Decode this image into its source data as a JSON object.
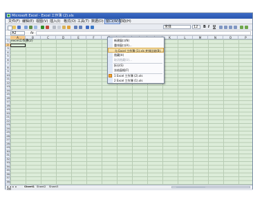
{
  "window": {
    "title": "Microsoft Excel - Excel 工作薄 (2).xls"
  },
  "menubar": {
    "items": [
      {
        "label": "文件(F)"
      },
      {
        "label": "编辑(E)"
      },
      {
        "label": "视图(V)"
      },
      {
        "label": "插入(I)"
      },
      {
        "label": "格式(O)"
      },
      {
        "label": "工具(T)"
      },
      {
        "label": "数据(D)"
      },
      {
        "label": "窗口(W)",
        "open": true
      },
      {
        "label": "帮助(H)"
      }
    ]
  },
  "toolbar": {
    "font_name": "宋体",
    "font_size": "12",
    "bold_label": "B",
    "italic_label": "I",
    "underline_label": "U"
  },
  "formula_bar": {
    "name_box": "A2",
    "fx_label": "fx",
    "formula": ""
  },
  "grid": {
    "columns": [
      "A",
      "B",
      "C",
      "D",
      "E",
      "F",
      "G",
      "H",
      "I",
      "J",
      "K",
      "L",
      "M",
      "N",
      "O",
      "P"
    ],
    "active_column": "A",
    "rows": [
      "1",
      "2",
      "3",
      "4",
      "5",
      "6",
      "7",
      "8",
      "9",
      "10",
      "11",
      "12",
      "13",
      "14",
      "15",
      "16",
      "17",
      "18",
      "19",
      "20",
      "21",
      "22",
      "23",
      "24",
      "25",
      "26",
      "27",
      "28",
      "29",
      "30",
      "31",
      "32",
      "33",
      "34",
      "35",
      "36",
      "37",
      "38"
    ],
    "active_row": "2",
    "cell_a1": "excel工作薄(2)"
  },
  "window_menu": {
    "items": [
      {
        "label": "新建窗口(N)",
        "enabled": true
      },
      {
        "label": "重排窗口(A)...",
        "enabled": true
      },
      {
        "label": "与 Excel 工作薄 (1).xls 并排比较(B)...",
        "enabled": true,
        "highlight": true
      },
      {
        "label": "隐藏(H)",
        "enabled": true
      },
      {
        "label": "取消隐藏(U)...",
        "enabled": false
      },
      {
        "label": "拆分(S)",
        "enabled": true
      },
      {
        "label": "冻结窗格(F)",
        "enabled": true
      },
      {
        "label": "1 Excel 工作薄 (2).xls",
        "enabled": true,
        "checked": true
      },
      {
        "label": "2 Excel 工作薄 (1).xls",
        "enabled": true
      }
    ]
  },
  "sheet_tabs": {
    "nav": "◂ ◂ ▸ ▸",
    "tabs": [
      {
        "label": "Sheet1",
        "active": true
      },
      {
        "label": "Sheet2"
      },
      {
        "label": "Sheet3"
      }
    ]
  },
  "status": {
    "text": "就绪"
  },
  "colors": {
    "grid_bg": "#dcecd9",
    "title_blue": "#2a56ad",
    "highlight": "#f5e2b0"
  }
}
